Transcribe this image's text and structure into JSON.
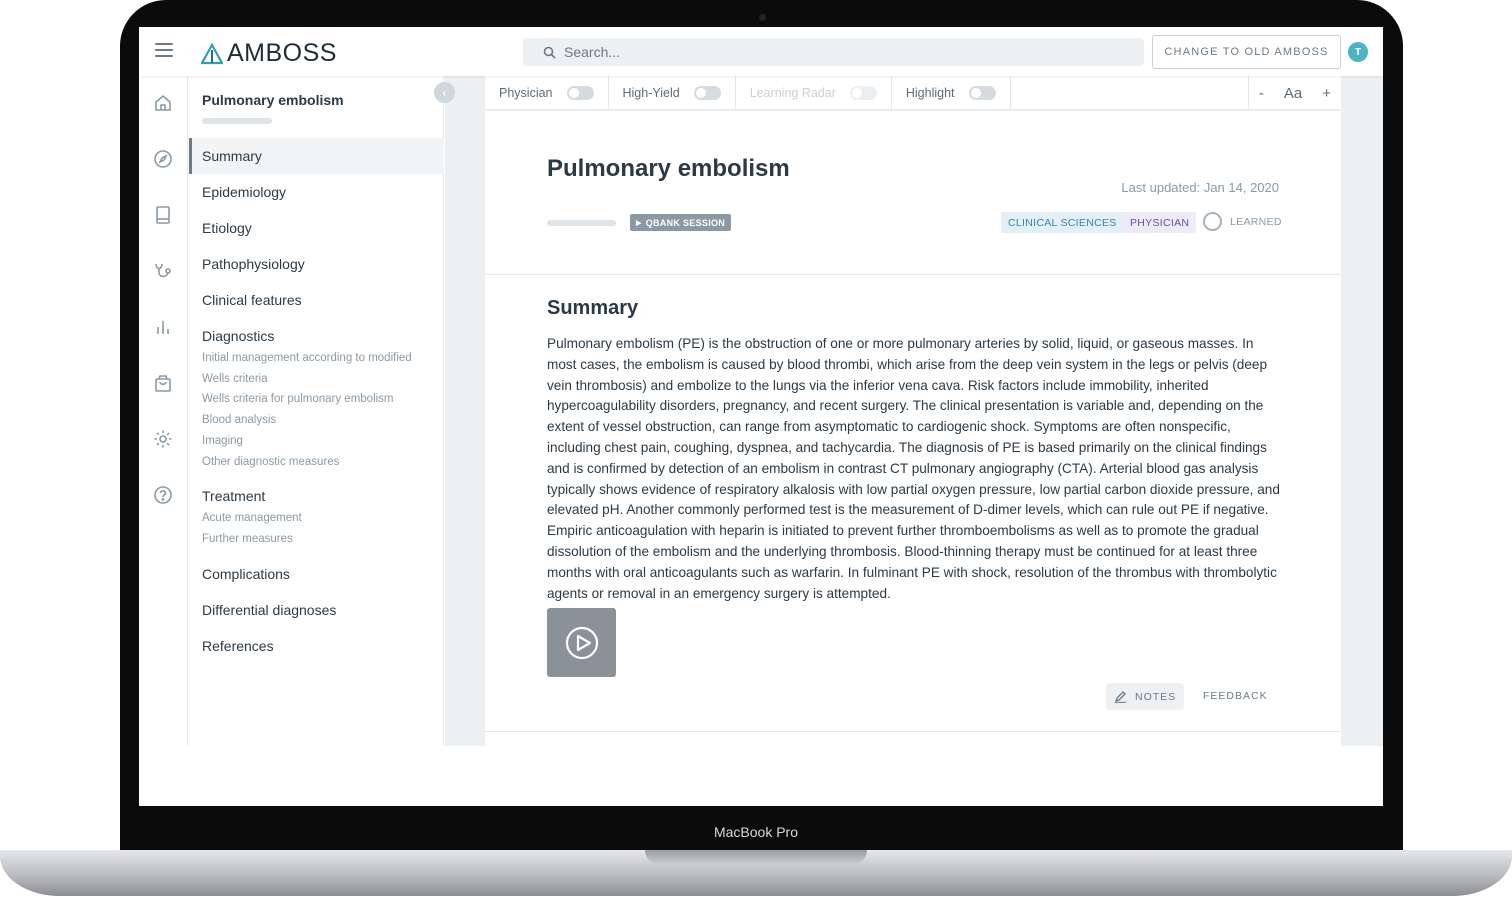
{
  "device": {
    "label": "MacBook Pro"
  },
  "header": {
    "logo_text": "AMBOSS",
    "search_placeholder": "Search...",
    "old_button": "CHANGE TO OLD AMBOSS",
    "avatar_initial": "T"
  },
  "rail": {
    "icons": [
      "home-icon",
      "compass-icon",
      "book-icon",
      "stethoscope-icon",
      "chart-icon",
      "bag-icon",
      "settings-icon",
      "help-icon"
    ]
  },
  "toc": {
    "title": "Pulmonary embolism",
    "progress": 0,
    "collapse_glyph": "‹",
    "items": {
      "summary": "Summary",
      "epidemiology": "Epidemiology",
      "etiology": "Etiology",
      "pathophysiology": "Pathophysiology",
      "clinical_features": "Clinical features",
      "diagnostics": "Diagnostics",
      "diag_sub": [
        "Initial management according to modified",
        "Wells criteria",
        "Wells criteria for pulmonary embolism",
        "Blood analysis",
        "Imaging",
        "Other diagnostic measures"
      ],
      "treatment": "Treatment",
      "treat_sub": [
        "Acute management",
        "Further measures"
      ],
      "complications": "Complications",
      "differential": "Differential diagnoses",
      "references": "References"
    }
  },
  "toolbar": {
    "physician": "Physician",
    "high_yield": "High-Yield",
    "learning_radar": "Learning Radar",
    "highlight": "Highlight",
    "font_minus": "-",
    "font_label": "Aa",
    "font_plus": "+"
  },
  "article": {
    "title": "Pulmonary embolism",
    "last_updated": "Last updated: Jan 14, 2020",
    "qbank": "QBANK SESSION",
    "tag_clinical": "CLINICAL SCIENCES",
    "tag_physician": "PHYSICIAN",
    "learned": "LEARNED",
    "summary_heading": "Summary",
    "summary_text": "Pulmonary embolism (PE) is the obstruction of one or more pulmonary arteries by solid, liquid, or gaseous masses. In most cases, the embolism is caused by blood thrombi, which arise from the deep vein system in the legs or pelvis (deep vein thrombosis) and embolize to the lungs via the inferior vena cava. Risk factors include immobility, inherited hypercoagulability disorders, pregnancy, and recent surgery. The clinical presentation is variable and, depending on the extent of vessel obstruction, can range from asymptomatic to cardiogenic shock. Symptoms are often nonspecific, including chest pain, coughing, dyspnea, and tachycardia. The diagnosis of PE is based primarily on the clinical findings and is confirmed by detection of an embolism in contrast CT pulmonary angiography (CTA). Arterial blood gas analysis typically shows evidence of respiratory alkalosis with low partial oxygen pressure, low partial carbon dioxide pressure, and elevated pH. Another commonly performed test is the measurement of D-dimer levels, which can rule out PE if negative. Empiric anticoagulation with heparin is initiated to prevent further thromboembolisms as well as to promote the gradual dissolution of the embolism and the underlying thrombosis. Blood-thinning therapy must be continued for at least three months with oral anticoagulants such as warfarin. In fulminant PE with shock, resolution of the thrombus with thrombolytic agents or removal in an emergency surgery is attempted.",
    "notes": "NOTES",
    "feedback": "FEEDBACK"
  },
  "colors": {
    "accent": "#4fb3c4",
    "text": "#2b3a46",
    "muted": "#8b99a4"
  }
}
